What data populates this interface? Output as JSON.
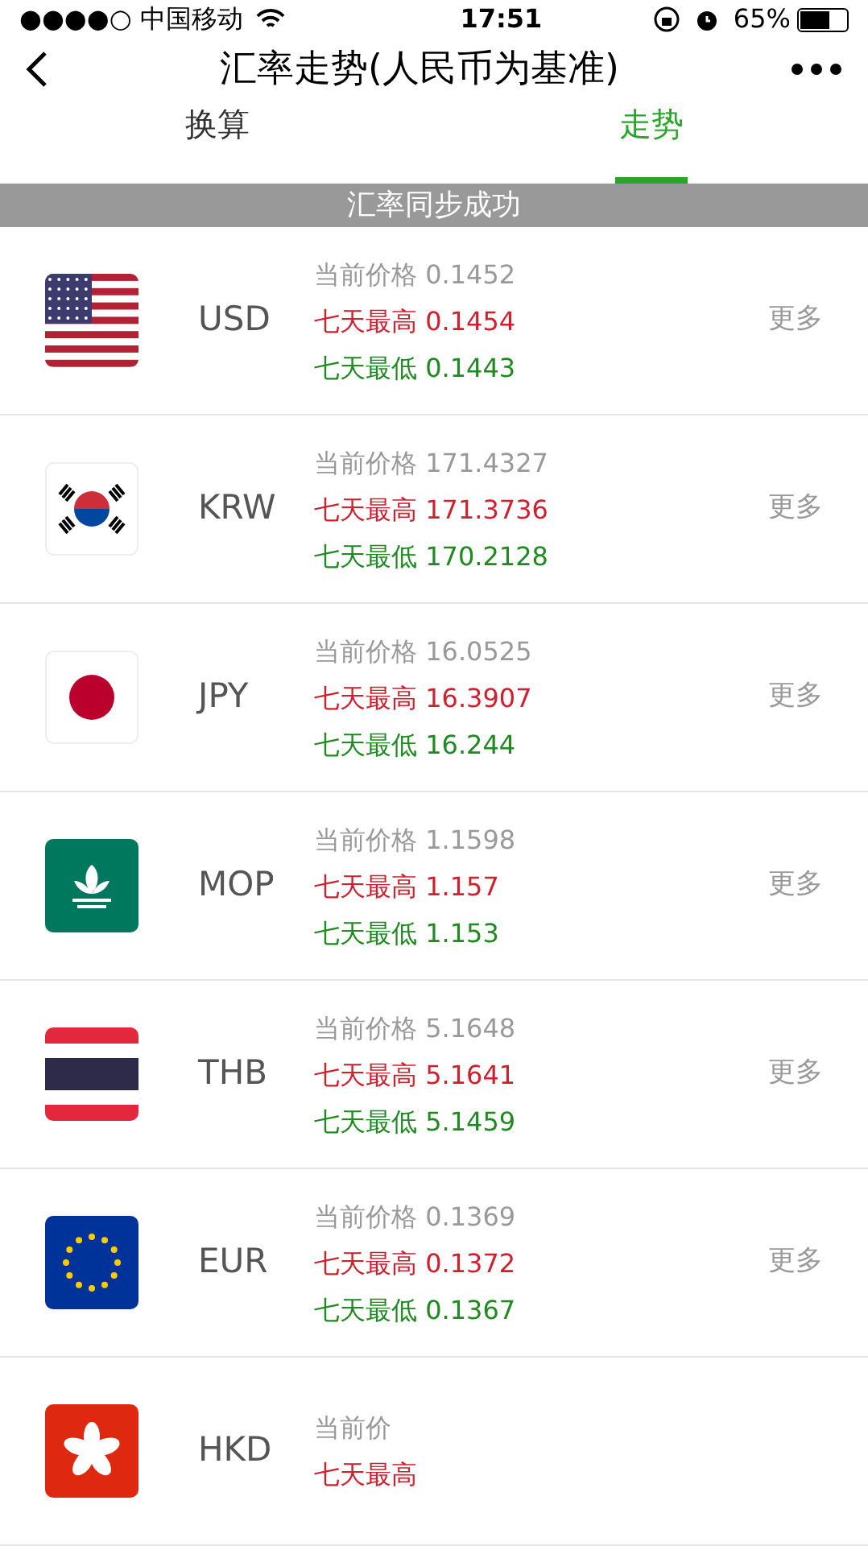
{
  "status_bar": {
    "carrier": "●●●●○ 中国移动",
    "time": "17:51",
    "battery": "65%"
  },
  "nav": {
    "title": "汇率走势(人民币为基准)"
  },
  "tabs": [
    {
      "label": "换算",
      "selected": false
    },
    {
      "label": "走势",
      "selected": true
    }
  ],
  "toast": "汇率同步成功",
  "rates": [
    {
      "code": "USD",
      "kind": "us",
      "current": "当前价格 0.1452",
      "high": "七天最高 0.1454",
      "low": "七天最低 0.1443",
      "more": "更多"
    },
    {
      "code": "KRW",
      "kind": "kr",
      "current": "当前价格 171.4327",
      "high": "七天最高 171.3736",
      "low": "七天最低 170.2128",
      "more": "更多"
    },
    {
      "code": "JPY",
      "kind": "jp",
      "current": "当前价格 16.0525",
      "high": "七天最高 16.3907",
      "low": "七天最低 16.244",
      "more": "更多"
    },
    {
      "code": "MOP",
      "kind": "mo",
      "current": "当前价格 1.1598",
      "high": "七天最高 1.157",
      "low": "七天最低 1.153",
      "more": "更多"
    },
    {
      "code": "THB",
      "kind": "th",
      "current": "当前价格 5.1648",
      "high": "七天最高 5.1641",
      "low": "七天最低 5.1459",
      "more": "更多"
    },
    {
      "code": "EUR",
      "kind": "eu",
      "current": "当前价格 0.1369",
      "high": "七天最高 0.1372",
      "low": "七天最低 0.1367",
      "more": "更多"
    },
    {
      "code": "HKD",
      "kind": "hk",
      "current": "当前价",
      "high": "七天最高"
    }
  ]
}
